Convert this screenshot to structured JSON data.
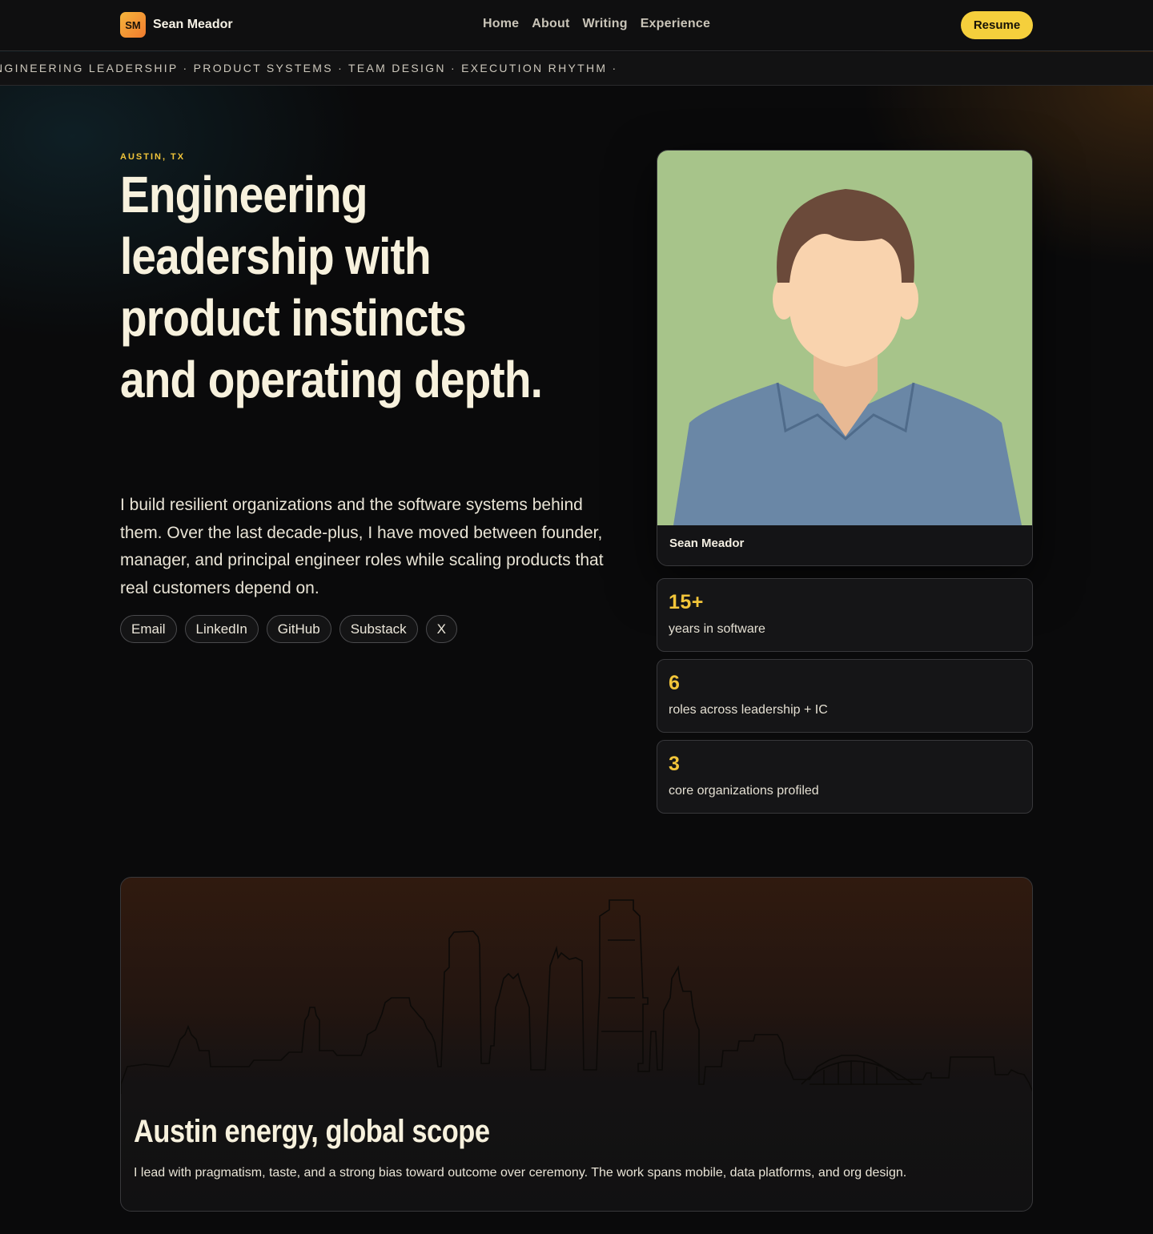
{
  "nav": {
    "brand_initials": "SM",
    "brand_name": "Sean Meador",
    "links": [
      "Home",
      "About",
      "Writing",
      "Experience"
    ],
    "resume_label": "Resume"
  },
  "ticker": {
    "text": "NGINEERING LEADERSHIP · PRODUCT SYSTEMS · TEAM DESIGN · EXECUTION RHYTHM ·"
  },
  "hero": {
    "eyebrow": "AUSTIN, TX",
    "headline": "Engineering leadership with product instincts and operating depth.",
    "intro": "I build resilient organizations and the software systems behind them. Over the last decade-plus, I have moved between founder, manager, and principal engineer roles while scaling products that real customers depend on.",
    "links": [
      "Email",
      "LinkedIn",
      "GitHub",
      "Substack",
      "X"
    ]
  },
  "portrait": {
    "caption": "Sean Meador",
    "colors": {
      "background": "#a7c48a",
      "hair": "#6b4a3a",
      "skin": "#f9d3ae",
      "shirt": "#6a87a6"
    }
  },
  "stats": [
    {
      "value": "15+",
      "label": "years in software"
    },
    {
      "value": "6",
      "label": "roles across leadership + IC"
    },
    {
      "value": "3",
      "label": "core organizations profiled"
    }
  ],
  "skyline_card": {
    "title": "Austin energy, global scope",
    "text": "I lead with pragmatism, taste, and a strong bias toward outcome over ceremony. The work spans mobile, data platforms, and org design."
  },
  "colors": {
    "accent": "#f2c53a",
    "resume_button": "#f5cf3c",
    "background": "#0a0a0b",
    "text": "#f3efe3"
  }
}
